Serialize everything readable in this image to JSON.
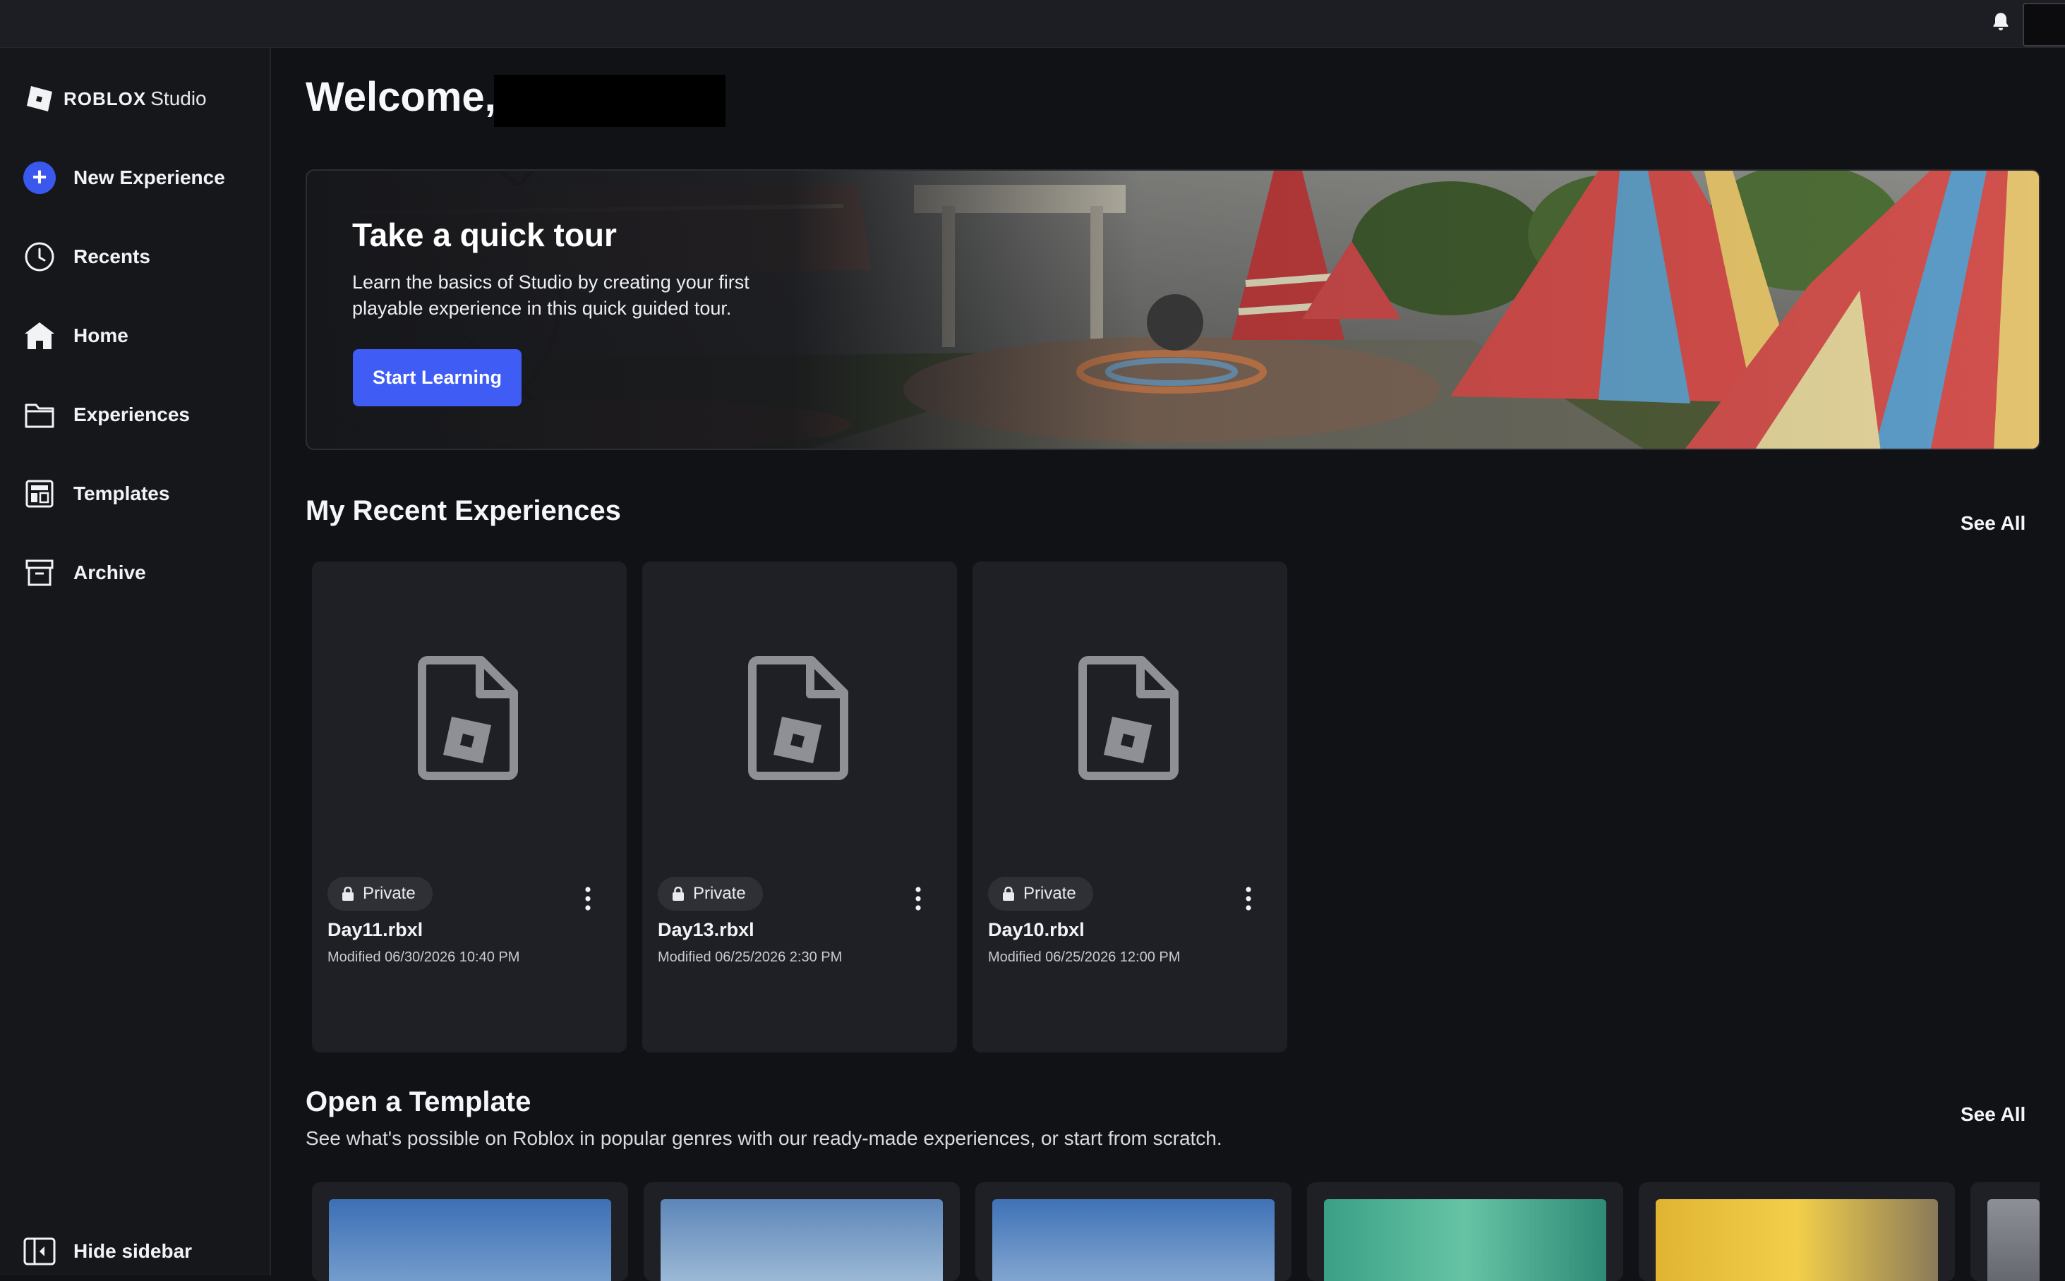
{
  "app": {
    "brand": "ROBLOX",
    "product": "Studio"
  },
  "sidebar": {
    "items": [
      {
        "label": "New Experience",
        "icon": "plus-circle-icon"
      },
      {
        "label": "Recents",
        "icon": "clock-icon"
      },
      {
        "label": "Home",
        "icon": "home-icon"
      },
      {
        "label": "Experiences",
        "icon": "folder-icon"
      },
      {
        "label": "Templates",
        "icon": "template-layout-icon"
      },
      {
        "label": "Archive",
        "icon": "archive-box-icon"
      }
    ],
    "hide_label": "Hide sidebar"
  },
  "main": {
    "welcome": "Welcome,",
    "hero": {
      "title": "Take a quick tour",
      "description": "Learn the basics of Studio by creating your first playable experience in this quick guided tour.",
      "button": "Start Learning"
    },
    "recent": {
      "title": "My Recent Experiences",
      "see_all": "See All",
      "cards": [
        {
          "badge": "Private",
          "name": "Day11.rbxl",
          "modified": "Modified 06/30/2026 10:40 PM"
        },
        {
          "badge": "Private",
          "name": "Day13.rbxl",
          "modified": "Modified 06/25/2026 2:30 PM"
        },
        {
          "badge": "Private",
          "name": "Day10.rbxl",
          "modified": "Modified 06/25/2026 12:00 PM"
        }
      ]
    },
    "templates": {
      "title": "Open a Template",
      "subtitle": "See what's possible on Roblox in popular genres with our ready-made experiences, or start from scratch.",
      "see_all": "See All"
    }
  },
  "colors": {
    "accent": "#3f5cf5",
    "background": "#111216",
    "sidebar": "#16171b",
    "card": "#1f2025"
  }
}
